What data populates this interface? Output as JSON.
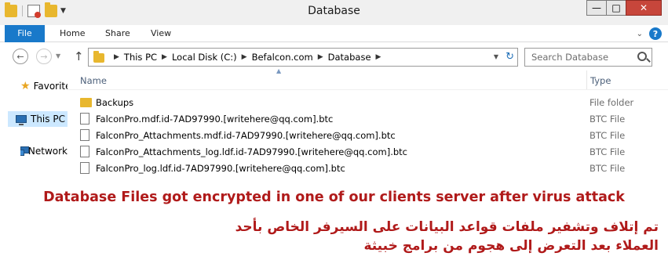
{
  "window": {
    "title": "Database",
    "minimize_glyph": "—",
    "maximize_glyph": "□",
    "close_glyph": "✕"
  },
  "ribbon": {
    "tabs": [
      {
        "label": "File",
        "active": true
      },
      {
        "label": "Home"
      },
      {
        "label": "Share"
      },
      {
        "label": "View"
      }
    ],
    "help_glyph": "?"
  },
  "address": {
    "breadcrumbs": [
      "This PC",
      "Local Disk (C:)",
      "Befalcon.com",
      "Database"
    ]
  },
  "search": {
    "placeholder": "Search Database"
  },
  "nav": {
    "items": [
      {
        "label": "Favorites",
        "icon": "star-icon"
      },
      {
        "label": "This PC",
        "icon": "pc-icon",
        "selected": true
      },
      {
        "label": "Network",
        "icon": "network-icon"
      }
    ]
  },
  "columns": {
    "name": "Name",
    "type": "Type"
  },
  "files": [
    {
      "name": "Backups",
      "type": "File folder",
      "icon": "folder-icon"
    },
    {
      "name": "FalconPro.mdf.id-7AD97990.[writehere@qq.com].btc",
      "type": "BTC File",
      "icon": "file-icon"
    },
    {
      "name": "FalconPro_Attachments.mdf.id-7AD97990.[writehere@qq.com].btc",
      "type": "BTC File",
      "icon": "file-icon"
    },
    {
      "name": "FalconPro_Attachments_log.ldf.id-7AD97990.[writehere@qq.com].btc",
      "type": "BTC File",
      "icon": "file-icon"
    },
    {
      "name": "FalconPro_log.ldf.id-7AD97990.[writehere@qq.com].btc",
      "type": "BTC File",
      "icon": "file-icon"
    }
  ],
  "caption": {
    "english": "Database Files got encrypted in one of our clients server after virus attack",
    "arabic": "تم إتلاف وتشفير ملفات قواعد البيانات  على السيرفر الخاص بأحد العملاء بعد التعرض إلى هجوم من برامج خبيثة",
    "color": "#b01a1a"
  },
  "colors": {
    "accent": "#1979ca",
    "selection": "#cce8ff",
    "folder": "#e8b72e"
  }
}
